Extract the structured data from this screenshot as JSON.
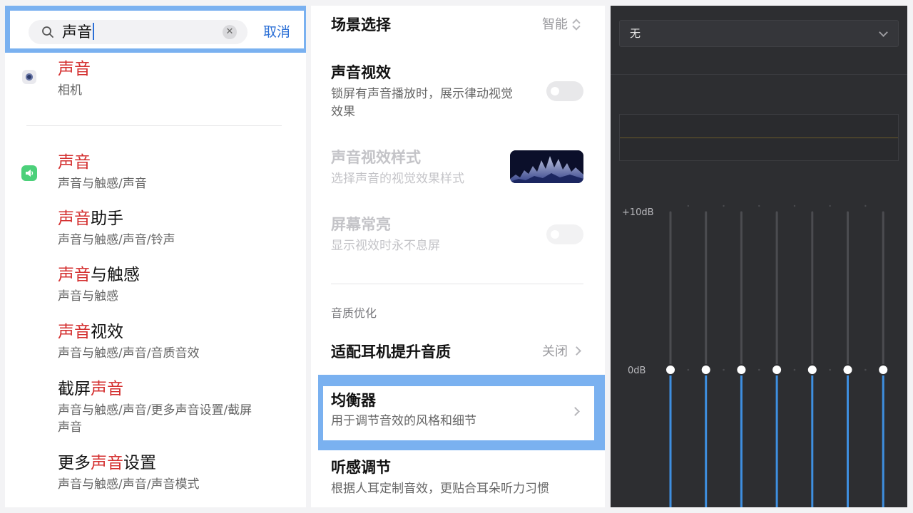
{
  "search_panel": {
    "query": "声音",
    "cancel_label": "取消",
    "results": [
      {
        "hit": "声音",
        "rest": "",
        "prefix": "",
        "path": "相机",
        "icon": "camera-icon"
      },
      {
        "hit": "声音",
        "rest": "",
        "prefix": "",
        "path": "声音与触感/声音",
        "icon": "sound-app-icon"
      },
      {
        "hit": "声音",
        "rest": "助手",
        "prefix": "",
        "path": "声音与触感/声音/铃声"
      },
      {
        "hit": "声音",
        "rest": "与触感",
        "prefix": "",
        "path": "声音与触感"
      },
      {
        "hit": "声音",
        "rest": "视效",
        "prefix": "",
        "path": "声音与触感/声音/音质音效"
      },
      {
        "hit": "声音",
        "rest": "",
        "prefix": "截屏",
        "path_line1": "声音与触感/声音/更多声音设置/截屏",
        "path_line2": "声音"
      },
      {
        "hit": "声音",
        "rest": "设置",
        "prefix": "更多",
        "path": "声音与触感/声音/声音模式"
      }
    ]
  },
  "settings_panel": {
    "scene": {
      "label": "场景选择",
      "value": "智能"
    },
    "sound_visual": {
      "label": "声音视效",
      "desc_line1": "锁屏有声音播放时，展示律动视觉",
      "desc_line2": "效果",
      "enabled": false
    },
    "visual_style": {
      "label": "声音视效样式",
      "desc": "选择声音的视觉效果样式"
    },
    "always_on": {
      "label": "屏幕常亮",
      "desc": "显示视效时永不息屏",
      "enabled": false
    },
    "section_quality": "音质优化",
    "headphone": {
      "label": "适配耳机提升音质",
      "value": "关闭"
    },
    "equalizer": {
      "label": "均衡器",
      "desc": "用于调节音效的风格和细节"
    },
    "hearing": {
      "label": "听感调节",
      "desc": "根据人耳定制音效，更贴合耳朵听力习惯"
    }
  },
  "eq_panel": {
    "preset": "无",
    "db_top": "+10dB",
    "db_zero": "0dB",
    "band_gains_db": [
      0,
      0,
      0,
      0,
      0,
      0,
      0
    ],
    "colors": {
      "active": "#3e8fe0",
      "track": "#4b4c50",
      "knob": "#ffffff",
      "bg": "#2d2e31"
    }
  },
  "colors": {
    "highlight": "#7ab1f0",
    "hit_text": "#d42f2f",
    "link": "#2b6fd6"
  }
}
